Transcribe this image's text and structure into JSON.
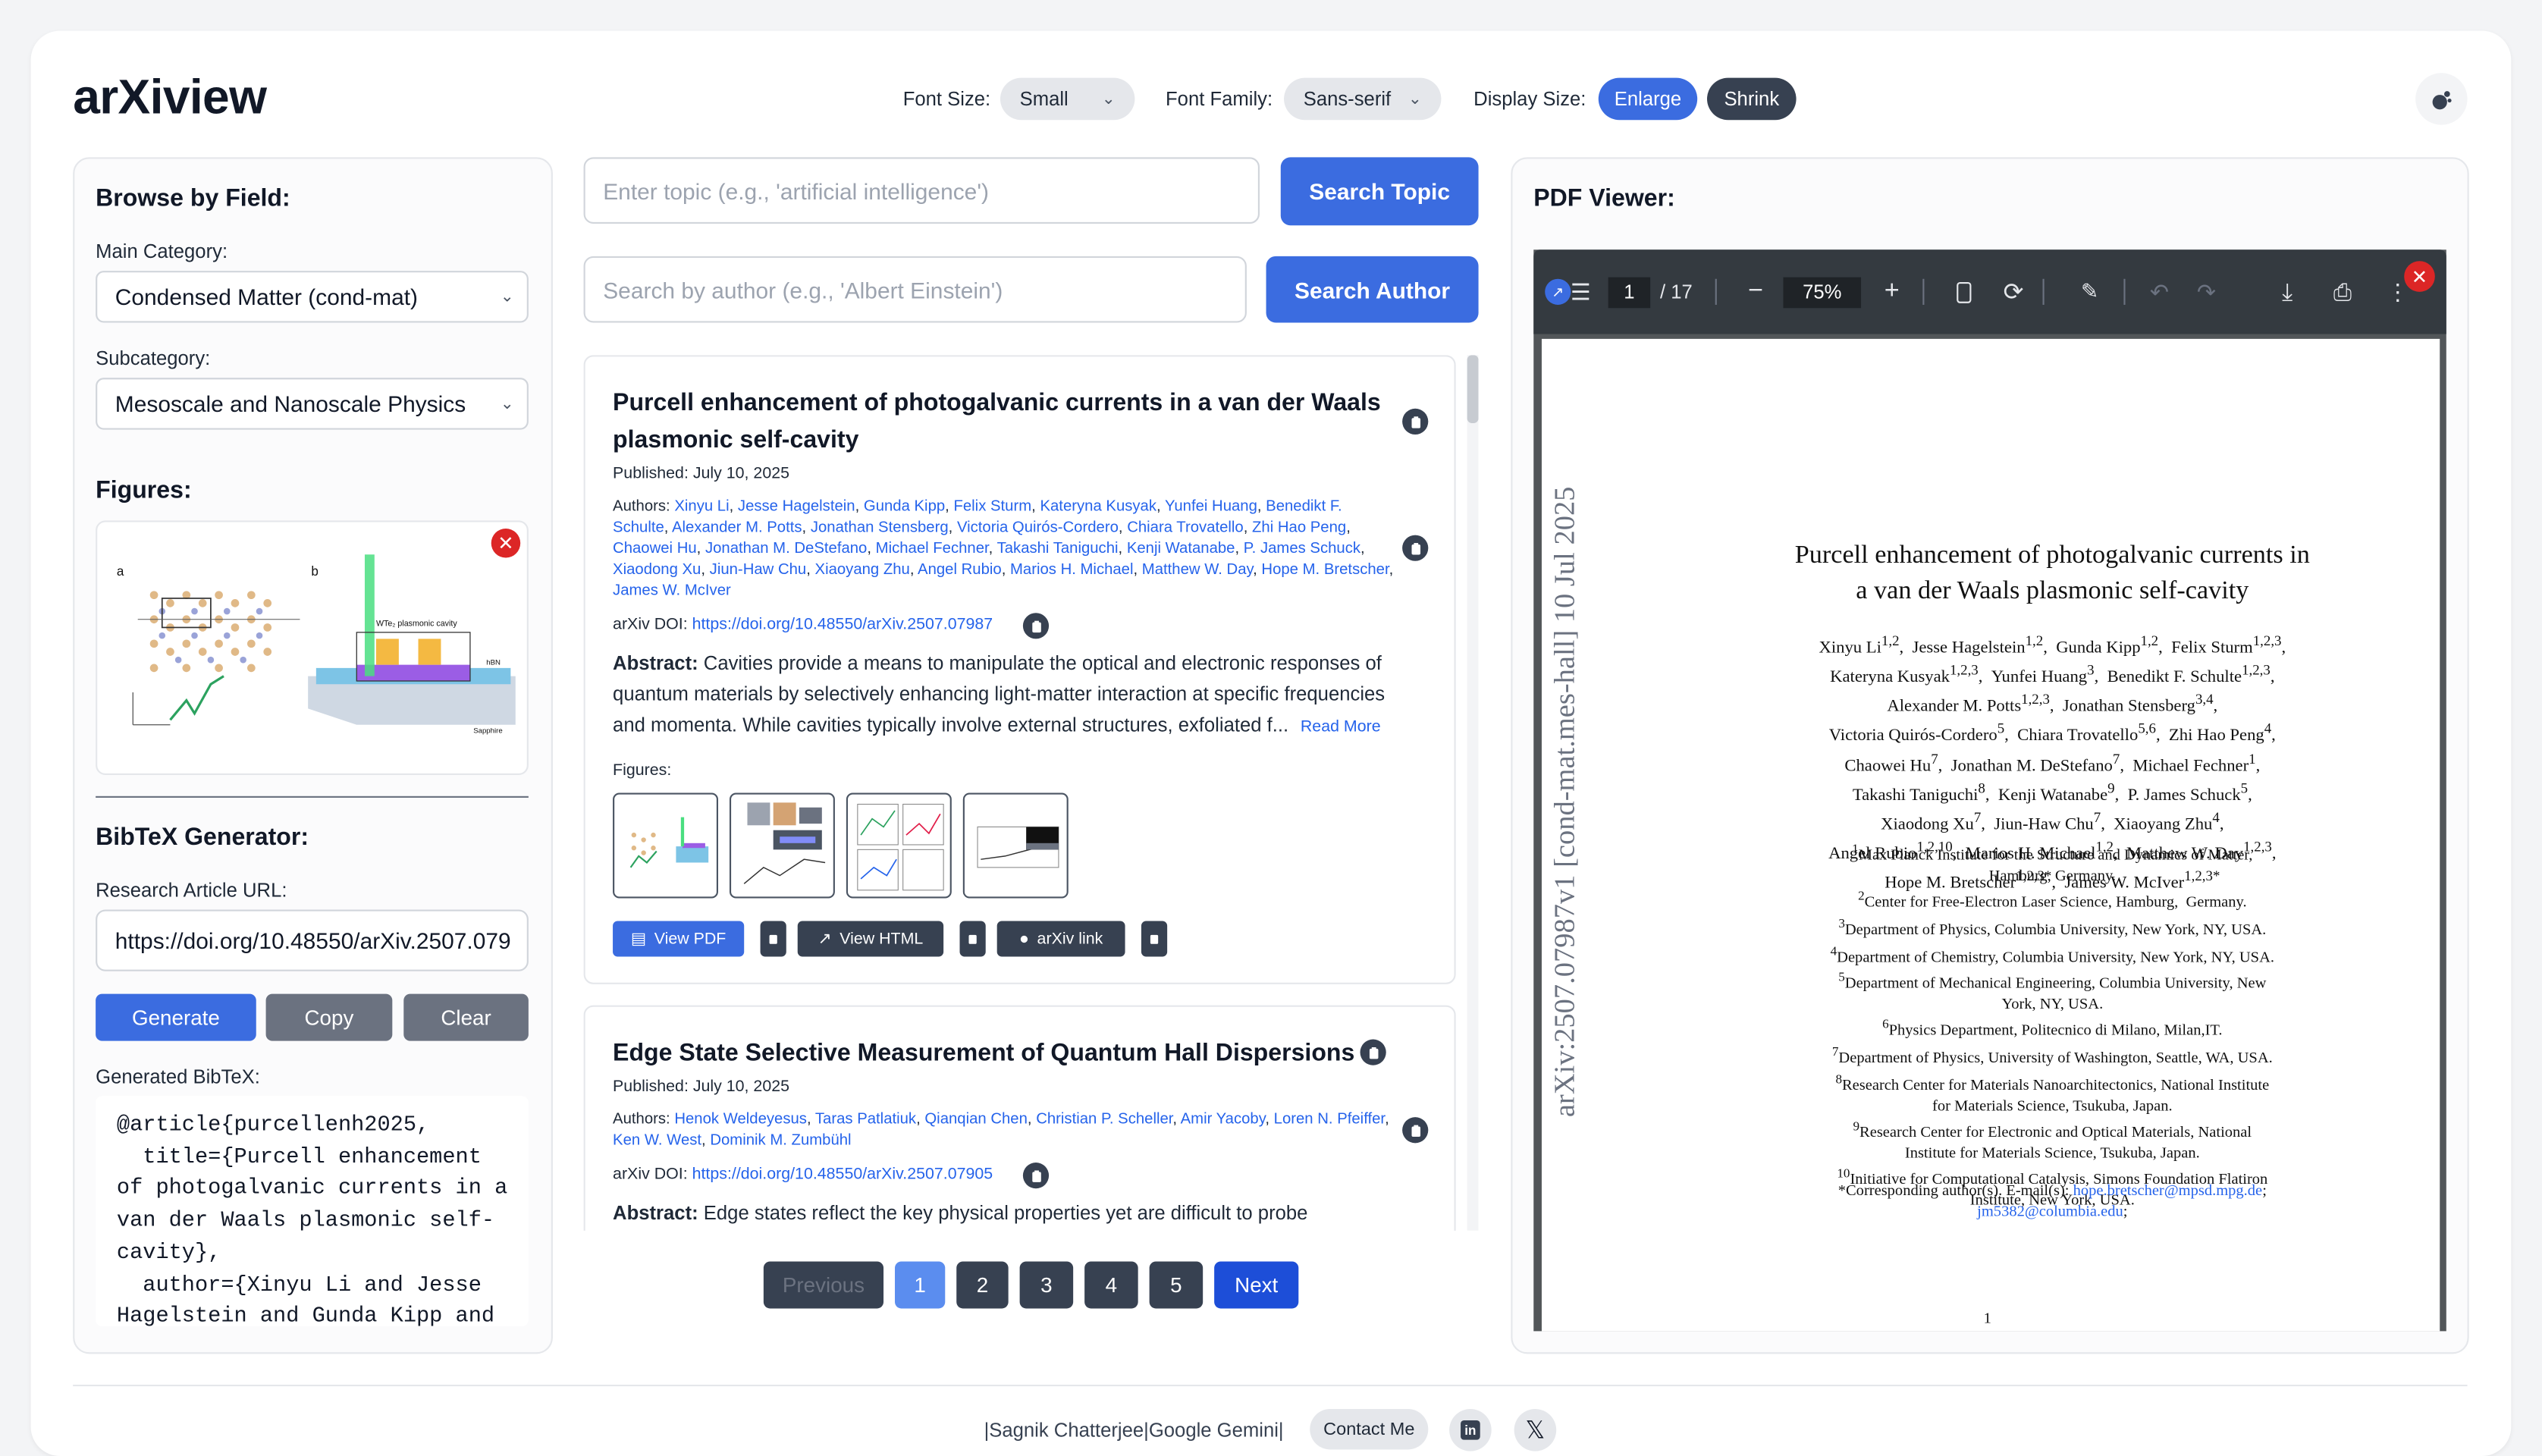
{
  "app": {
    "logo": "arXiview",
    "font_size_label": "Font Size:",
    "font_size_value": "Small",
    "font_family_label": "Font Family:",
    "font_family_value": "Sans-serif",
    "display_size_label": "Display Size:",
    "enlarge": "Enlarge",
    "shrink": "Shrink"
  },
  "sidebar": {
    "browse_title": "Browse by Field:",
    "main_category_label": "Main Category:",
    "main_category": "Condensed Matter (cond-mat)",
    "subcategory_label": "Subcategory:",
    "subcategory": "Mesoscale and Nanoscale Physics",
    "figures_title": "Figures:",
    "bibtex_title": "BibTeX Generator:",
    "url_label": "Research Article URL:",
    "url_value": "https://doi.org/10.48550/arXiv.2507.079",
    "generate": "Generate",
    "copy": "Copy",
    "clear": "Clear",
    "generated_label": "Generated BibTeX:",
    "bibtex_lines": [
      "@article{purcellenh2025,",
      "  title={Purcell enhancement",
      "of photogalvanic currents in a",
      "van der Waals plasmonic self-",
      "cavity},",
      "  author={Xinyu Li and Jesse",
      "Hagelstein and Gunda Kipp and"
    ]
  },
  "search": {
    "topic_placeholder": "Enter topic (e.g., 'artificial intelligence')",
    "topic_button": "Search Topic",
    "author_placeholder": "Search by author (e.g., 'Albert Einstein')",
    "author_button": "Search Author"
  },
  "articles": [
    {
      "title_line1": "Purcell enhancement of photogalvanic currents in a van der Waals",
      "title_line2": "plasmonic self-cavity",
      "published": "Published: July 10, 2025",
      "authors_label": "Authors: ",
      "doi_label": "arXiv DOI: ",
      "doi": "https://doi.org/10.48550/arXiv.2507.07987",
      "abstract_label": "Abstract:",
      "abstract_line1": " Cavities provide a means to manipulate the optical and electronic responses of",
      "abstract_line2": "quantum materials by selectively enhancing light-matter interaction at specific frequencies",
      "abstract_line3": "and momenta. While cavities typically involve external structures, exfoliated f...",
      "read_more": "Read More",
      "figures_label": "Figures:",
      "view_pdf": "View PDF",
      "view_html": "View HTML",
      "arxiv_link": "arXiv link"
    },
    {
      "title": "Edge State Selective Measurement of Quantum Hall Dispersions",
      "published": "Published: July 10, 2025",
      "authors_label": "Authors: ",
      "doi_label": "arXiv DOI: ",
      "doi": "https://doi.org/10.48550/arXiv.2507.07905",
      "abstract_label": "Abstract:",
      "abstract_line1": " Edge states reflect the key physical properties yet are difficult to probe"
    }
  ],
  "pagination": {
    "previous": "Previous",
    "pages": [
      "1",
      "2",
      "3",
      "4",
      "5"
    ],
    "next": "Next"
  },
  "pdf": {
    "title": "PDF Viewer:",
    "page_current": "1",
    "page_total": "/ 17",
    "zoom": "75%",
    "side_stamp": "arXiv:2507.07987v1  [cond-mat.mes-hall]  10 Jul 2025",
    "paper_title_1": "Purcell enhancement of photogalvanic currents in",
    "paper_title_2": "a van der Waals plasmonic self-cavity",
    "corresponding": "*Corresponding author(s). E-mail(s):",
    "email1": "hope.bretscher@mpsd.mpg.de",
    "email2": "jm5382@columbia.edu",
    "page_number": "1"
  },
  "footer": {
    "credits": "|Sagnik Chatterjee|Google Gemini|",
    "contact": "Contact Me"
  }
}
